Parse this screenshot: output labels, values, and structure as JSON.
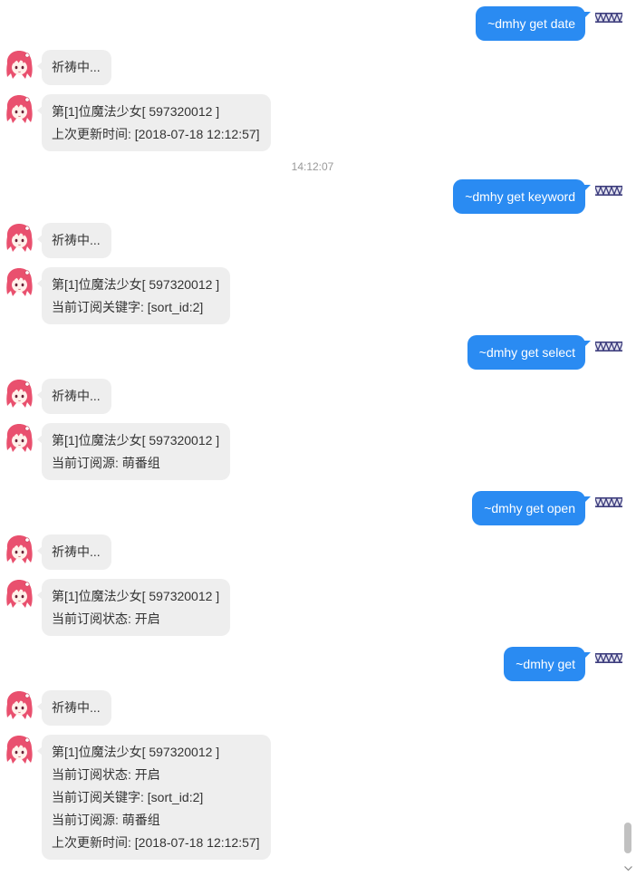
{
  "colors": {
    "background": "#ffffff",
    "outgoing_bubble": "#2a8bf2",
    "outgoing_text": "#ffffff",
    "incoming_bubble": "#eeeeee",
    "incoming_text": "#333333",
    "timestamp_text": "#999999",
    "scrollbar_thumb": "#c1c1c1"
  },
  "chat": {
    "items": [
      {
        "avatar_icon": "zigzag-banner-avatar-icon",
        "lines": [
          "~dmhy get date"
        ]
      },
      {
        "avatar_icon": "anime-girl-avatar-icon",
        "lines": [
          "祈祷中..."
        ]
      },
      {
        "avatar_icon": "anime-girl-avatar-icon",
        "lines": [
          "第[1]位魔法少女[ 597320012 ]",
          "上次更新时间: [2018-07-18 12:12:57]"
        ]
      },
      {
        "timestamp": "14:12:07"
      },
      {
        "avatar_icon": "zigzag-banner-avatar-icon",
        "lines": [
          "~dmhy get keyword"
        ]
      },
      {
        "avatar_icon": "anime-girl-avatar-icon",
        "lines": [
          "祈祷中..."
        ]
      },
      {
        "avatar_icon": "anime-girl-avatar-icon",
        "lines": [
          "第[1]位魔法少女[ 597320012 ]",
          "当前订阅关键字: [sort_id:2]"
        ]
      },
      {
        "avatar_icon": "zigzag-banner-avatar-icon",
        "lines": [
          "~dmhy get select"
        ]
      },
      {
        "avatar_icon": "anime-girl-avatar-icon",
        "lines": [
          "祈祷中..."
        ]
      },
      {
        "avatar_icon": "anime-girl-avatar-icon",
        "lines": [
          "第[1]位魔法少女[ 597320012 ]",
          "当前订阅源: 萌番组"
        ]
      },
      {
        "avatar_icon": "zigzag-banner-avatar-icon",
        "lines": [
          "~dmhy get open"
        ]
      },
      {
        "avatar_icon": "anime-girl-avatar-icon",
        "lines": [
          "祈祷中..."
        ]
      },
      {
        "avatar_icon": "anime-girl-avatar-icon",
        "lines": [
          "第[1]位魔法少女[ 597320012 ]",
          "当前订阅状态: 开启"
        ]
      },
      {
        "avatar_icon": "zigzag-banner-avatar-icon",
        "lines": [
          "~dmhy get"
        ]
      },
      {
        "avatar_icon": "anime-girl-avatar-icon",
        "lines": [
          "祈祷中..."
        ]
      },
      {
        "avatar_icon": "anime-girl-avatar-icon",
        "lines": [
          "第[1]位魔法少女[ 597320012 ]",
          "当前订阅状态: 开启",
          "当前订阅关键字: [sort_id:2]",
          "当前订阅源: 萌番组",
          "上次更新时间: [2018-07-18 12:12:57]"
        ]
      }
    ]
  },
  "scrollbar": {
    "down_icon": "chevron-down-icon"
  }
}
